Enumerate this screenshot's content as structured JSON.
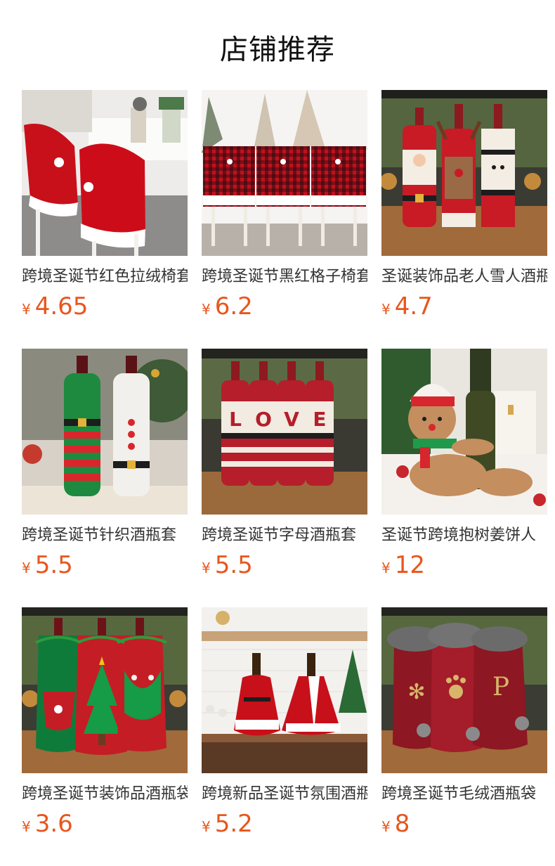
{
  "page": {
    "title": "店铺推荐",
    "currency_symbol": "¥"
  },
  "products": [
    {
      "name": "跨境圣诞节红色拉绒椅套",
      "price": "4.65",
      "image": "santa-hat-chair-covers"
    },
    {
      "name": "跨境圣诞节黑红格子椅套",
      "price": "6.2",
      "image": "plaid-chair-covers"
    },
    {
      "name": "圣诞装饰品老人雪人酒瓶套",
      "price": "4.7",
      "image": "santa-reindeer-snowman-bottle-covers"
    },
    {
      "name": "跨境圣诞节针织酒瓶套",
      "price": "5.5",
      "image": "knitted-bottle-covers"
    },
    {
      "name": "跨境圣诞节字母酒瓶套",
      "price": "5.5",
      "image": "love-letter-bottle-covers"
    },
    {
      "name": "圣诞节跨境抱树姜饼人",
      "price": "12",
      "image": "gingerbread-bottle-hugger"
    },
    {
      "name": "跨境圣诞节装饰品酒瓶袋",
      "price": "3.6",
      "image": "drawstring-bottle-bags"
    },
    {
      "name": "跨境新品圣诞节氛围酒瓶套",
      "price": "5.2",
      "image": "santa-dress-bottle-covers"
    },
    {
      "name": "跨境圣诞节毛绒酒瓶袋",
      "price": "8",
      "image": "plush-fur-bottle-bags"
    }
  ],
  "colors": {
    "accent": "#e8561d",
    "text": "#333333",
    "title": "#111111"
  }
}
